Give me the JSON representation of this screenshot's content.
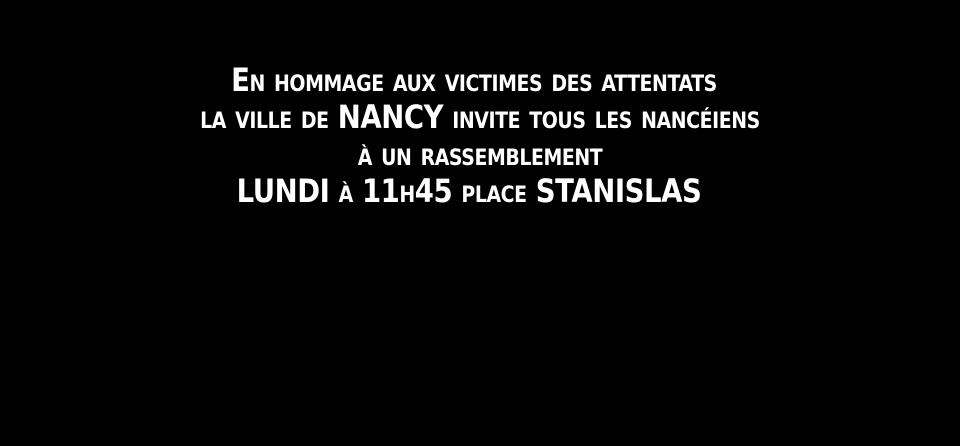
{
  "background_color": "#000000",
  "text_color": "#ffffff",
  "message": {
    "lines": [
      "En hommage aux victimes des attentats",
      "la ville de NANCY invite tous les nancéiens",
      "à un rassemblement",
      "LUNDI à 11h45 place STANISLAS"
    ]
  }
}
